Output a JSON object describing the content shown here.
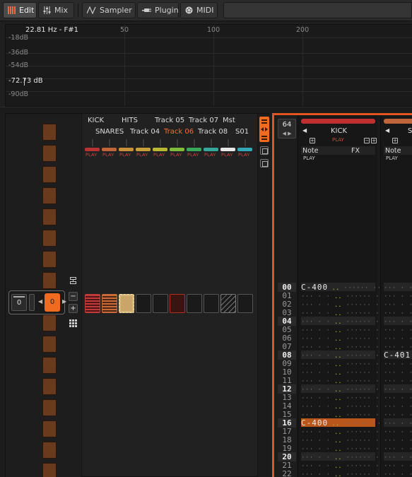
{
  "toolbar": {
    "edit_label": "Edit",
    "mix_label": "Mix",
    "sampler_label": "Sampler",
    "plugin_label": "Plugin",
    "midi_label": "MIDI"
  },
  "spectrum": {
    "readout_freq": "22.81 Hz - F#1",
    "readout_db": "-72.73 dB",
    "db_labels": [
      "-18dB",
      "-36dB",
      "-54dB",
      "-72dB",
      "-90dB"
    ],
    "hz_labels": [
      "50",
      "100",
      "200"
    ]
  },
  "sampler": {
    "track_names_top": [
      "KICK",
      "HITS",
      "Track 05",
      "Track 07",
      "Mst"
    ],
    "track_names_bottom": [
      "SNARES",
      "Track 04",
      "Track 06",
      "Track 08",
      "S01"
    ],
    "play_label": "PLAY",
    "pager_left_value": "0",
    "pager_active_value": "0",
    "track_colors": [
      "#b83434",
      "#c0653a",
      "#c9913a",
      "#c8a03a",
      "#b9b832",
      "#7fbd3a",
      "#3aa85a",
      "#36a79a",
      "#e8e8e8",
      "#35a8b8"
    ]
  },
  "pattern": {
    "length": "64",
    "rows": [
      "00",
      "01",
      "02",
      "03",
      "04",
      "05",
      "06",
      "07",
      "08",
      "09",
      "10",
      "11",
      "12",
      "13",
      "14",
      "15",
      "16",
      "17",
      "18",
      "19",
      "20",
      "21",
      "22"
    ],
    "tracks": [
      {
        "name": "KICK",
        "color": "#c03030",
        "play": "PLAY",
        "col_note": "Note",
        "col_fx": "FX",
        "col_play": "PLAY",
        "cells": {
          "00": "C-400",
          "16": "C-400"
        }
      },
      {
        "name": "SN",
        "color": "#c0653a",
        "play": "",
        "col_note": "Note",
        "col_fx": "",
        "col_play": "PLAY",
        "cells": {
          "08": "C-401"
        }
      }
    ]
  }
}
